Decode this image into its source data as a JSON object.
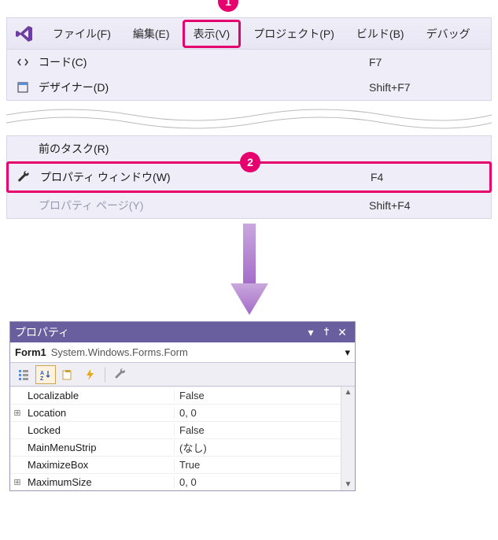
{
  "menubar": {
    "items": [
      {
        "label": "ファイル(F)"
      },
      {
        "label": "編集(E)"
      },
      {
        "label": "表示(V)"
      },
      {
        "label": "プロジェクト(P)"
      },
      {
        "label": "ビルド(B)"
      },
      {
        "label": "デバッグ"
      }
    ],
    "dropdown": [
      {
        "icon": "code-icon",
        "label": "コード(C)",
        "shortcut": "F7"
      },
      {
        "icon": "designer-icon",
        "label": "デザイナー(D)",
        "shortcut": "Shift+F7"
      }
    ]
  },
  "dropdown2": [
    {
      "label": "前のタスク(R)",
      "shortcut": ""
    },
    {
      "icon": "wrench-icon",
      "label": "プロパティ ウィンドウ(W)",
      "shortcut": "F4"
    },
    {
      "label": "プロパティ ページ(Y)",
      "shortcut": "Shift+F4",
      "disabled": true
    }
  ],
  "callouts": {
    "one": "1",
    "two": "2"
  },
  "properties_window": {
    "title": "プロパティ",
    "selection": {
      "name": "Form1",
      "type": "System.Windows.Forms.Form"
    },
    "rows": [
      {
        "expand": "",
        "name": "Localizable",
        "value": "False"
      },
      {
        "expand": "⊞",
        "name": "Location",
        "value": "0, 0"
      },
      {
        "expand": "",
        "name": "Locked",
        "value": "False"
      },
      {
        "expand": "",
        "name": "MainMenuStrip",
        "value": "(なし)"
      },
      {
        "expand": "",
        "name": "MaximizeBox",
        "value": "True"
      },
      {
        "expand": "⊞",
        "name": "MaximumSize",
        "value": "0, 0"
      }
    ]
  }
}
